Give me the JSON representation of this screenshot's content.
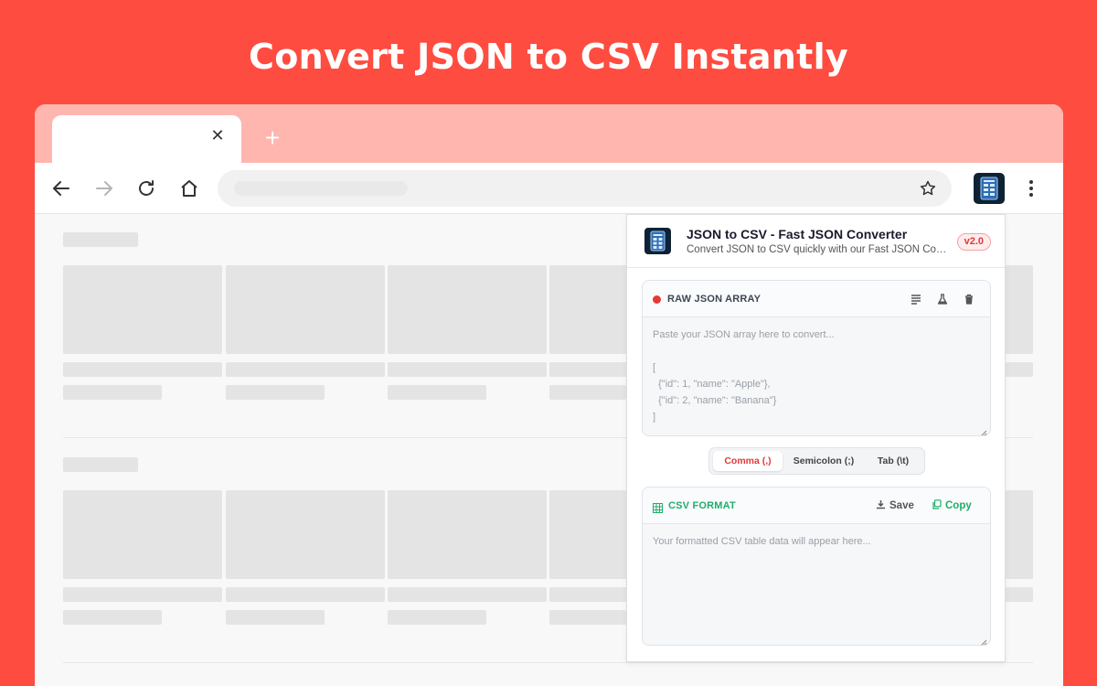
{
  "headline": "Convert JSON to CSV Instantly",
  "browser": {
    "tab_close": "✕",
    "new_tab": "+"
  },
  "popup": {
    "title": "JSON to CSV - Fast JSON Converter",
    "subtitle": "Convert JSON to CSV quickly with our Fast JSON Converter",
    "version": "v2.0",
    "input_panel": {
      "label": "RAW JSON ARRAY",
      "placeholder": "Paste your JSON array here to convert...\n\n[\n  {\"id\": 1, \"name\": \"Apple\"},\n  {\"id\": 2, \"name\": \"Banana\"}\n]"
    },
    "delimiters": [
      {
        "label": "Comma (,)",
        "active": true
      },
      {
        "label": "Semicolon (;)",
        "active": false
      },
      {
        "label": "Tab (\\t)",
        "active": false
      }
    ],
    "output_panel": {
      "label": "CSV FORMAT",
      "save_label": "Save",
      "copy_label": "Copy",
      "placeholder": "Your formatted CSV table data will appear here..."
    }
  },
  "colors": {
    "background": "#FF4C40",
    "tabbar": "#FFB6AF",
    "accent_red": "#E0393B",
    "accent_green": "#1FAE6A",
    "label_dark": "#3d4656"
  }
}
